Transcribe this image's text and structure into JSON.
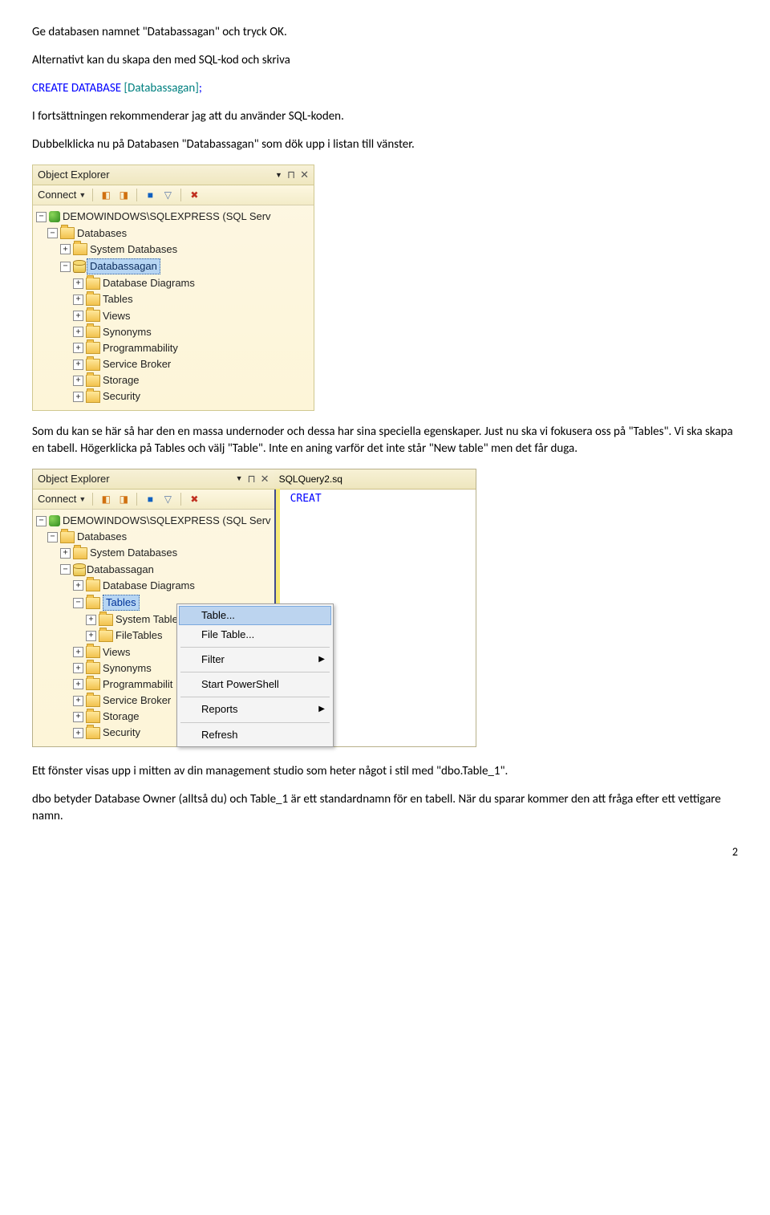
{
  "text": {
    "p1": "Ge databasen namnet \"Databassagan\" och tryck OK.",
    "p2": "Alternativt kan du skapa den med SQL-kod och skriva",
    "sql_create": "CREATE DATABASE",
    "sql_obj": "[Databassagan]",
    "sql_end": ";",
    "p3": "I fortsättningen rekommenderar jag att du använder SQL-koden.",
    "p4": "Dubbelklicka nu på Databasen \"Databassagan\" som dök upp i listan till vänster.",
    "p5": "Som du kan se här så har den en massa undernoder och dessa har sina speciella egenskaper. Just nu ska vi fokusera oss på \"Tables\". Vi ska skapa en tabell. Högerklicka på Tables och välj \"Table\". Inte en aning varför det inte står \"New table\" men det får duga.",
    "p6": "Ett fönster visas upp i mitten av din management studio som heter något i stil med \"dbo.Table_1\".",
    "p7": "dbo betyder Database Owner (alltså du) och Table_1 är ett standardnamn för en tabell. När du sparar kommer den att fråga efter ett vettigare namn.",
    "page_number": "2"
  },
  "explorer1": {
    "title": "Object Explorer",
    "connect": "Connect",
    "server": "DEMOWINDOWS\\SQLEXPRESS (SQL Serv",
    "databases": "Databases",
    "sysdb": "System Databases",
    "dbname": "Databassagan",
    "children": {
      "diagrams": "Database Diagrams",
      "tables": "Tables",
      "views": "Views",
      "synonyms": "Synonyms",
      "prog": "Programmability",
      "sb": "Service Broker",
      "storage": "Storage",
      "security": "Security"
    }
  },
  "explorer2": {
    "title": "Object Explorer",
    "connect": "Connect",
    "server": "DEMOWINDOWS\\SQLEXPRESS (SQL Serv",
    "databases": "Databases",
    "sysdb": "System Databases",
    "dbname": "Databassagan",
    "children": {
      "diagrams": "Database Diagrams",
      "tables": "Tables",
      "systables": "System Table",
      "filetables": "FileTables",
      "views": "Views",
      "synonyms": "Synonyms",
      "prog": "Programmabilit",
      "sb": "Service Broker",
      "storage": "Storage",
      "security": "Security"
    },
    "tab": "SQLQuery2.sq",
    "code": "CREAT"
  },
  "context_menu": {
    "table": "Table...",
    "filetable": "File Table...",
    "filter": "Filter",
    "powershell": "Start PowerShell",
    "reports": "Reports",
    "refresh": "Refresh"
  }
}
